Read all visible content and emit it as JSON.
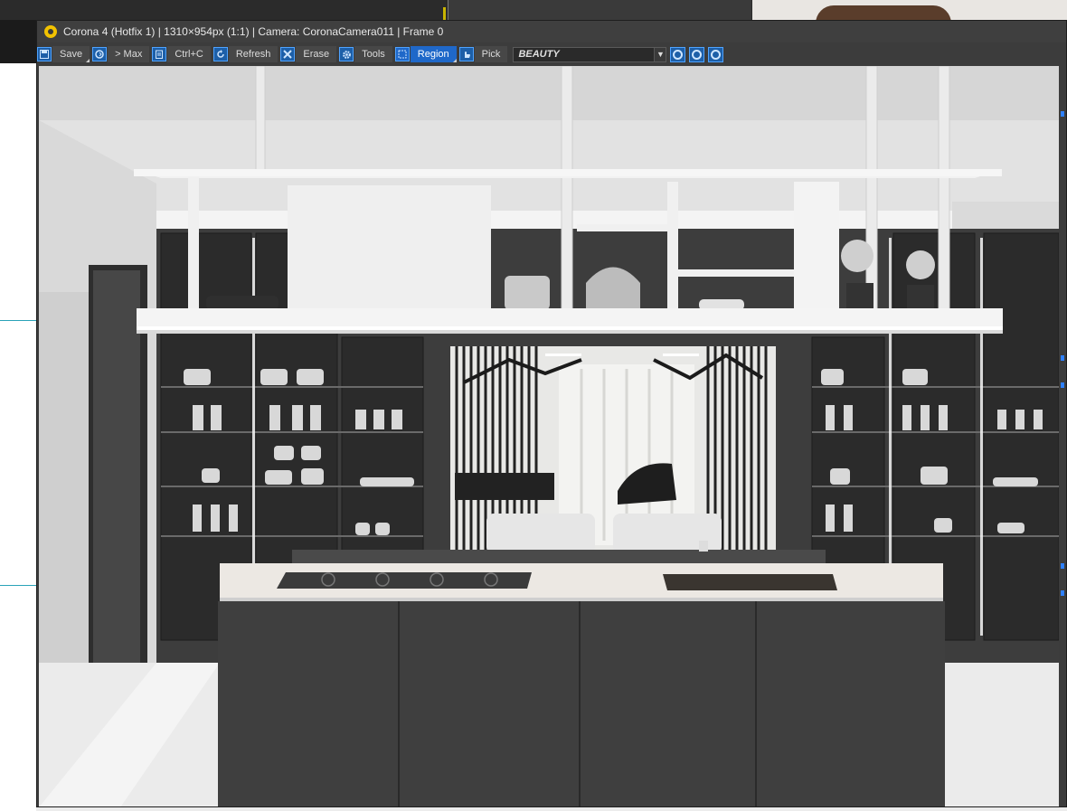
{
  "window": {
    "title": "Corona 4 (Hotfix 1) | 1310×954px (1:1) | Camera: CoronaCamera011 | Frame 0"
  },
  "toolbar": {
    "buttons": [
      {
        "label": "Save",
        "icon": "save-icon",
        "active": false
      },
      {
        "label": "> Max",
        "icon": "copy-to-max-icon",
        "active": false
      },
      {
        "label": "Ctrl+C",
        "icon": "clipboard-icon",
        "active": false
      },
      {
        "label": "Refresh",
        "icon": "refresh-icon",
        "active": false
      },
      {
        "label": "Erase",
        "icon": "erase-icon",
        "active": false
      },
      {
        "label": "Tools",
        "icon": "gear-icon",
        "active": false
      },
      {
        "label": "Region",
        "icon": "region-icon",
        "active": true
      },
      {
        "label": "Pick",
        "icon": "hand-pick-icon",
        "active": false
      }
    ],
    "channel": "BEAUTY",
    "zoom_buttons": [
      "zoom-in-icon",
      "zoom-out-icon",
      "zoom-fit-icon"
    ]
  },
  "render": {
    "description_icon": "rendered-kitchen-image"
  },
  "colors": {
    "accent": "#1f68c9",
    "window_bg": "#3c3c3c",
    "titlebar": "#3f3f3f"
  }
}
